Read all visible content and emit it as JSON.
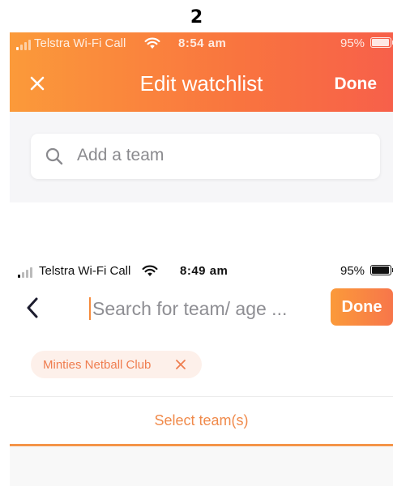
{
  "step_number": "2",
  "screen1": {
    "status_bar": {
      "carrier": "Telstra Wi-Fi Call",
      "time": "8:54 am",
      "battery": "95%"
    },
    "header": {
      "close_icon": "close-icon",
      "title": "Edit watchlist",
      "done_label": "Done"
    },
    "search": {
      "icon": "search-icon",
      "placeholder": "Add a team"
    },
    "colors": {
      "header_gradient_start": "#fb9a3a",
      "header_gradient_end": "#f7604a",
      "background": "#f6f6f8"
    }
  },
  "screen2": {
    "status_bar": {
      "carrier": "Telstra Wi-Fi Call",
      "time": "8:49 am",
      "battery": "95%"
    },
    "toolbar": {
      "back_icon": "chevron-left-icon",
      "search_placeholder": "Search for team/ age ...",
      "done_label": "Done"
    },
    "selected_chips": [
      {
        "label": "Minties Netball Club",
        "remove_icon": "close-icon"
      }
    ],
    "tab": {
      "label": "Select team(s)"
    },
    "colors": {
      "accent": "#f08a4b",
      "chip_background": "#fdf0ea"
    }
  }
}
